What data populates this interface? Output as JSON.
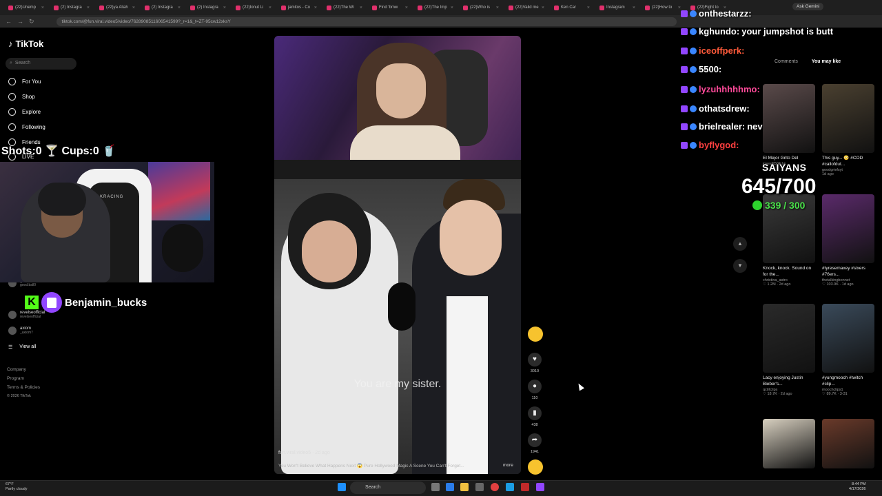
{
  "browser": {
    "tabs": [
      "(22)Unemp",
      "(2) Instagra",
      "(22)ya Allah",
      "(2) Instagra",
      "(2) Instagra",
      "(22)Ionut Li",
      "jamitos - Co",
      "(22)The Wi",
      "Find 'bmw",
      "(22)The Imp",
      "(22)Who is",
      "(22)Valid me",
      "Ken Car",
      "Instagram",
      "(22)How to",
      "(22)Fight to"
    ],
    "url": "tiktok.com/@fun.viral.video5/video/7628908511606541599?_r=1&_t=ZT-95cw12xksY",
    "gemini_label": "Ask Gemini"
  },
  "sidebar": {
    "logo": "TikTok",
    "search_placeholder": "Search",
    "nav": [
      {
        "label": "For You",
        "icon": "home-icon"
      },
      {
        "label": "Shop",
        "icon": "bag-icon"
      },
      {
        "label": "Explore",
        "icon": "compass-icon"
      },
      {
        "label": "Following",
        "icon": "following-icon"
      },
      {
        "label": "Friends",
        "icon": "friends-icon"
      },
      {
        "label": "LIVE",
        "icon": "live-icon"
      }
    ],
    "accounts": [
      {
        "name": "good.ball0",
        "handle": "good.ball0"
      },
      {
        "name": "revelseofficial",
        "handle": "revelseofficial"
      },
      {
        "name": "axiom",
        "handle": "_axiom7"
      }
    ],
    "view_all": "View all",
    "footer": [
      "Company",
      "Program",
      "Terms & Policies",
      "© 2026 TikTok"
    ]
  },
  "overlay": {
    "score": "Shots:0 🍸 Cups:0 🥤",
    "streamer": "Benjamin_bucks",
    "kick_letter": "K",
    "chair_text": "AKRACING",
    "saiyans": "SAIYANS",
    "counter": "645/700",
    "counter2": "339 / 300"
  },
  "chat": [
    {
      "user": "onthestarzz:",
      "msg": ""
    },
    {
      "user": "kghundo:",
      "msg": "your jumpshot is butt"
    },
    {
      "user": "iceoffperk:",
      "msg": ""
    },
    {
      "user": "5500:",
      "msg": ""
    },
    {
      "user": "lyzuhhhhhmo:",
      "msg": ""
    },
    {
      "user": "othatsdrew:",
      "msg": ""
    },
    {
      "user": "brielrealer:",
      "msg": "never"
    },
    {
      "user": "byflygod:",
      "msg": ""
    }
  ],
  "video": {
    "caption": "You are my sister.",
    "author": "fun.viral.video5 · 2d ago",
    "description": "You Won't Believe What Happens Next 😱 Pure Hollywood Magic  A Scene You Can't Forget...",
    "more": "more",
    "likes": "3010",
    "comments": "110",
    "saves": "438",
    "shares": "1941"
  },
  "right_panel": {
    "tabs": [
      "Comments",
      "You may like"
    ],
    "videos": [
      {
        "caption": "El Mejor Grito Del",
        "author": "joseslit504.hn",
        "meta": ""
      },
      {
        "caption": "This guy... 😳 #COD #callofdut...",
        "author": "goodgriefsyt",
        "meta": "1d ago"
      },
      {
        "caption": "Knock, knock. Sound on for the...",
        "author": "christina_astro",
        "meta": "♡ 1.2M · 2d ago"
      },
      {
        "caption": "#tyresemaxey #sixers #76ers...",
        "author": "thetalkingbonnet",
        "meta": "♡ 103.9K · 1d ago"
      },
      {
        "caption": "Lacy enjoying Justin Bieber's...",
        "author": "qctrlclips",
        "meta": "♡ 18.7K · 2d ago"
      },
      {
        "caption": "#yungmooch #twitch #clip...",
        "author": "moochclips1",
        "meta": "♡ 89.7K · 3-31"
      }
    ]
  },
  "taskbar": {
    "temp": "67°F",
    "weather": "Partly cloudy",
    "search": "Search",
    "time": "8:44 PM",
    "date": "4/17/2026"
  }
}
